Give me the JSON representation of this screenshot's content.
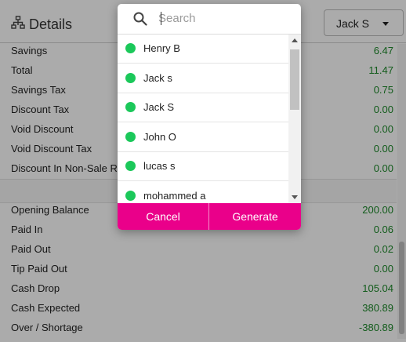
{
  "header": {
    "title": "Details",
    "employee_select": "Jack S"
  },
  "details_top": [
    {
      "label": "Savings",
      "value": "6.47"
    },
    {
      "label": "Total",
      "value": "11.47"
    },
    {
      "label": "Savings Tax",
      "value": "0.75"
    },
    {
      "label": "Discount Tax",
      "value": "0.00"
    },
    {
      "label": "Void Discount",
      "value": "0.00"
    },
    {
      "label": "Void Discount Tax",
      "value": "0.00"
    },
    {
      "label": "Discount In Non-Sale R",
      "value": "0.00"
    }
  ],
  "details_bottom": [
    {
      "label": "Opening Balance",
      "value": "200.00"
    },
    {
      "label": "Paid In",
      "value": "0.06"
    },
    {
      "label": "Paid Out",
      "value": "0.02"
    },
    {
      "label": "Tip Paid Out",
      "value": "0.00"
    },
    {
      "label": "Cash Drop",
      "value": "105.04"
    },
    {
      "label": "Cash Expected",
      "value": "380.89"
    },
    {
      "label": "Over / Shortage",
      "value": "-380.89"
    }
  ],
  "modal": {
    "search_placeholder": "Search",
    "employees": [
      {
        "name": "Henry B",
        "status": "online"
      },
      {
        "name": "Jack s",
        "status": "online"
      },
      {
        "name": "Jack S",
        "status": "online"
      },
      {
        "name": "John O",
        "status": "online"
      },
      {
        "name": "lucas s",
        "status": "online"
      },
      {
        "name": "mohammed a",
        "status": "online"
      }
    ],
    "cancel_label": "Cancel",
    "generate_label": "Generate"
  },
  "colors": {
    "accent": "#ea008a",
    "value_green": "#1d8a2a",
    "status_dot": "#1bc85a"
  }
}
